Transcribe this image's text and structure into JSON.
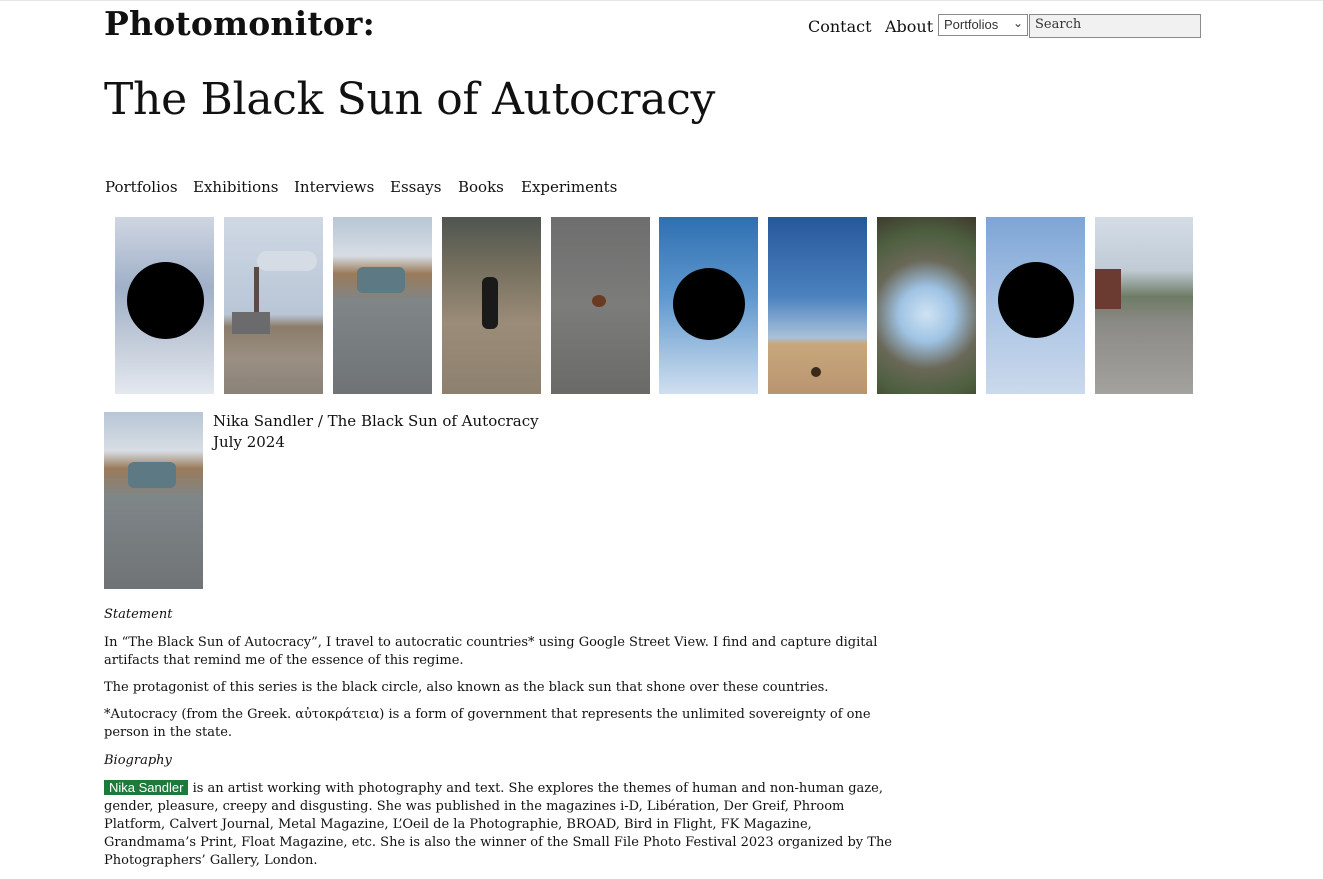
{
  "header": {
    "logo": "Photomonitor:",
    "nav": [
      "Contact",
      "About"
    ],
    "select_value": "Portfolios",
    "search_placeholder": "Search"
  },
  "page": {
    "title": "The Black Sun of Autocracy"
  },
  "main_nav": [
    "Portfolios",
    "Exhibitions",
    "Interviews",
    "Essays",
    "Books",
    "Experiments"
  ],
  "gallery": {
    "thumbnails": [
      {
        "subject": "black sun over cloudy sky"
      },
      {
        "subject": "factory chimney with smoke"
      },
      {
        "subject": "car on cracked road"
      },
      {
        "subject": "figure on dirt ground"
      },
      {
        "subject": "object on gravel"
      },
      {
        "subject": "black sun over blue sky"
      },
      {
        "subject": "desert landscape"
      },
      {
        "subject": "warped panorama"
      },
      {
        "subject": "black sun over pale blue sky"
      },
      {
        "subject": "temple courtyard"
      }
    ]
  },
  "credit": {
    "line1": "Nika Sandler / The Black Sun of Autocracy",
    "line2": "July 2024"
  },
  "statement": {
    "heading": "Statement",
    "p1": "In “The Black Sun of Autocracy”, I travel to autocratic countries* using Google Street View. I find and capture digital artifacts that remind me of the essence of this regime.",
    "p2": "The protagonist of this series is the black circle, also known as the black sun that shone over these countries.",
    "p3": "*Autocracy (from the Greek. αὐτοκράτεια) is a form of government that represents the unlimited sovereignty of one person in the state."
  },
  "biography": {
    "heading": "Biography",
    "name": "Nika Sandler",
    "text": "is an artist working with photography and text. She explores the themes of human and non-human gaze, gender, pleasure, creepy and disgusting. She was published in the magazines i-D, Libération, Der Greif, Phroom Platform, Calvert Journal, Metal Magazine, L’Oeil de la Photographie, BROAD, Bird in Flight, FK Magazine, Grandmama’s Print, Float Magazine, etc. She is also the winner of the Small File Photo Festival 2023 organized by The Photographers’ Gallery, London."
  },
  "colors": {
    "highlight": "#1c7a3a",
    "search_bg": "#f1f1f1"
  }
}
